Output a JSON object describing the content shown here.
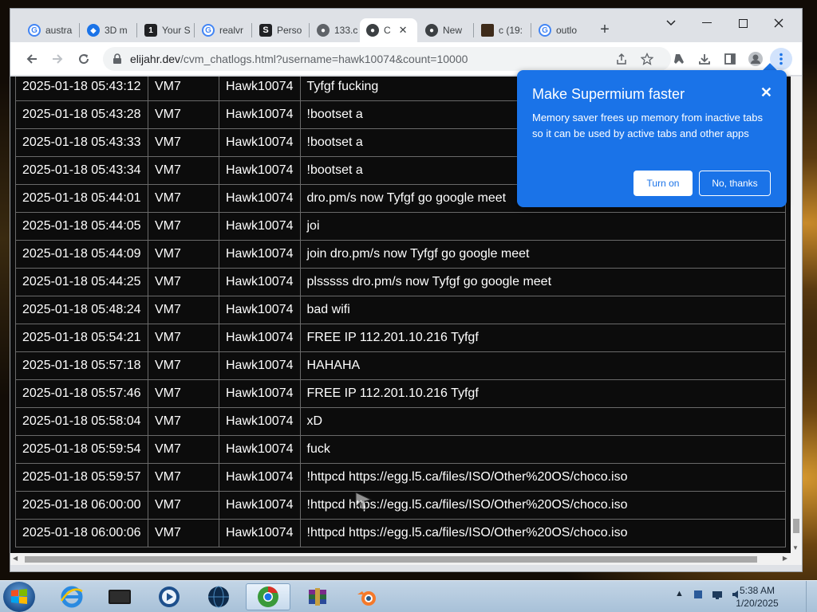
{
  "browser": {
    "tabs": [
      {
        "label": "austra",
        "icon": "google-icon"
      },
      {
        "label": "3D m",
        "icon": "3d-icon"
      },
      {
        "label": "Your S",
        "icon": "number-one-icon"
      },
      {
        "label": "realvr",
        "icon": "google-icon"
      },
      {
        "label": "Perso",
        "icon": "s-logo-icon"
      },
      {
        "label": "133.c",
        "icon": "globe-icon"
      },
      {
        "label": "C",
        "icon": "globe-icon",
        "active": true
      },
      {
        "label": "New",
        "icon": "globe-icon"
      },
      {
        "label": "c (19:",
        "icon": "thumbnail-icon"
      },
      {
        "label": "outlo",
        "icon": "google-icon"
      }
    ],
    "url_host": "elijahr.dev",
    "url_path": "/cvm_chatlogs.html?username=hawk10074&count=10000"
  },
  "chatlogs": {
    "rows": [
      {
        "time": "2025-01-18 05:43:12",
        "vm": "VM7",
        "user": "Hawk10074",
        "message": "Tyfgf fucking"
      },
      {
        "time": "2025-01-18 05:43:28",
        "vm": "VM7",
        "user": "Hawk10074",
        "message": "!bootset a"
      },
      {
        "time": "2025-01-18 05:43:33",
        "vm": "VM7",
        "user": "Hawk10074",
        "message": "!bootset a"
      },
      {
        "time": "2025-01-18 05:43:34",
        "vm": "VM7",
        "user": "Hawk10074",
        "message": "!bootset a"
      },
      {
        "time": "2025-01-18 05:44:01",
        "vm": "VM7",
        "user": "Hawk10074",
        "message": "dro.pm/s now Tyfgf go google meet"
      },
      {
        "time": "2025-01-18 05:44:05",
        "vm": "VM7",
        "user": "Hawk10074",
        "message": "joi"
      },
      {
        "time": "2025-01-18 05:44:09",
        "vm": "VM7",
        "user": "Hawk10074",
        "message": "join dro.pm/s now Tyfgf go google meet"
      },
      {
        "time": "2025-01-18 05:44:25",
        "vm": "VM7",
        "user": "Hawk10074",
        "message": "plsssss dro.pm/s now Tyfgf go google meet"
      },
      {
        "time": "2025-01-18 05:48:24",
        "vm": "VM7",
        "user": "Hawk10074",
        "message": "bad wifi"
      },
      {
        "time": "2025-01-18 05:54:21",
        "vm": "VM7",
        "user": "Hawk10074",
        "message": "FREE IP 112.201.10.216 Tyfgf"
      },
      {
        "time": "2025-01-18 05:57:18",
        "vm": "VM7",
        "user": "Hawk10074",
        "message": "HAHAHA"
      },
      {
        "time": "2025-01-18 05:57:46",
        "vm": "VM7",
        "user": "Hawk10074",
        "message": "FREE IP 112.201.10.216 Tyfgf"
      },
      {
        "time": "2025-01-18 05:58:04",
        "vm": "VM7",
        "user": "Hawk10074",
        "message": "xD"
      },
      {
        "time": "2025-01-18 05:59:54",
        "vm": "VM7",
        "user": "Hawk10074",
        "message": "fuck"
      },
      {
        "time": "2025-01-18 05:59:57",
        "vm": "VM7",
        "user": "Hawk10074",
        "message": "!httpcd https://egg.l5.ca/files/ISO/Other%20OS/choco.iso"
      },
      {
        "time": "2025-01-18 06:00:00",
        "vm": "VM7",
        "user": "Hawk10074",
        "message": "!httpcd https://egg.l5.ca/files/ISO/Other%20OS/choco.iso"
      },
      {
        "time": "2025-01-18 06:00:06",
        "vm": "VM7",
        "user": "Hawk10074",
        "message": "!httpcd https://egg.l5.ca/files/ISO/Other%20OS/choco.iso"
      }
    ]
  },
  "popup": {
    "title": "Make Supermium faster",
    "body": "Memory saver frees up memory from inactive tabs so it can be used by active tabs and other apps",
    "turn_on": "Turn on",
    "no_thanks": "No, thanks"
  },
  "taskbar": {
    "apps": [
      "internet-explorer-icon",
      "terminal-icon",
      "media-player-icon",
      "globe-app-icon",
      "chrome-icon",
      "winrar-icon",
      "blender-icon"
    ],
    "time": "5:38 AM",
    "date": "1/20/2025"
  },
  "colors": {
    "accent": "#1a73e8",
    "page_bg": "#0c0c0c",
    "grid": "#6a6a6a"
  }
}
